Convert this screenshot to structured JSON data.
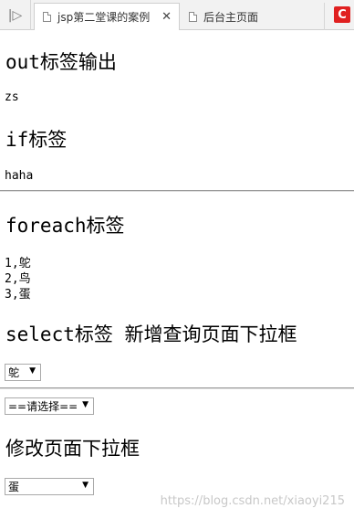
{
  "browser": {
    "tabs": [
      {
        "title": "jsp第二堂课的案例",
        "active": true
      },
      {
        "title": "后台主页面",
        "active": false
      }
    ]
  },
  "page": {
    "out_heading": "out标签输出",
    "out_value": "zs",
    "if_heading": "if标签",
    "if_value": "haha",
    "foreach_heading": "foreach标签",
    "foreach_items": [
      "1,鸵",
      "2,鸟",
      "3,蛋"
    ],
    "select_heading": "select标签 新增查询页面下拉框",
    "select1_value": "鸵",
    "select2_value": "==请选择==",
    "edit_heading": "修改页面下拉框",
    "select3_value": "蛋"
  },
  "watermark": "https://blog.csdn.net/xiaoyi215"
}
